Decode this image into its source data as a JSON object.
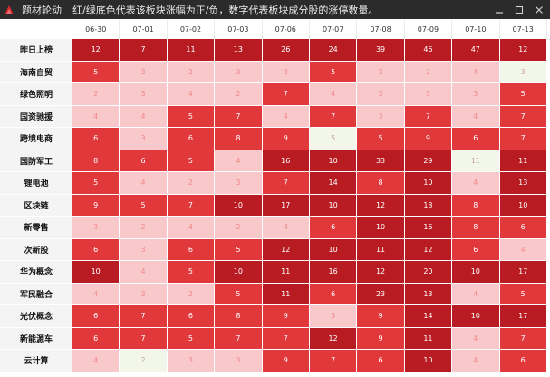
{
  "window": {
    "app_title": "题材轮动",
    "subtitle": "红/绿底色代表该板块涨幅为正/负，数字代表板块成分股的涨停数量。",
    "icon": "app-logo-icon",
    "buttons": [
      "minimize-icon",
      "maximize-icon",
      "close-icon"
    ]
  },
  "colors": {
    "deep_red": "#b81c22",
    "red": "#e0383b",
    "pink": "#f9c8ca",
    "pale_green": "#f3f7ea"
  },
  "dates": [
    "06-30",
    "07-01",
    "07-02",
    "07-03",
    "07-06",
    "07-07",
    "07-08",
    "07-09",
    "07-10",
    "07-13"
  ],
  "rows": [
    {
      "label": "昨日上榜",
      "values": [
        12,
        7,
        11,
        13,
        26,
        24,
        39,
        46,
        47,
        12
      ],
      "tones": [
        "d",
        "d",
        "d",
        "d",
        "d",
        "d",
        "d",
        "d",
        "d",
        "d"
      ]
    },
    {
      "label": "海南自贸",
      "values": [
        5,
        3,
        2,
        3,
        3,
        5,
        3,
        2,
        4,
        3
      ],
      "tones": [
        "r",
        "p",
        "p",
        "p",
        "p",
        "r",
        "p",
        "p",
        "p",
        "g"
      ]
    },
    {
      "label": "绿色照明",
      "values": [
        2,
        3,
        4,
        2,
        7,
        4,
        3,
        3,
        3,
        5
      ],
      "tones": [
        "p",
        "p",
        "p",
        "p",
        "r",
        "p",
        "p",
        "p",
        "p",
        "r"
      ]
    },
    {
      "label": "国资驰援",
      "values": [
        4,
        4,
        5,
        7,
        4,
        7,
        3,
        7,
        4,
        7
      ],
      "tones": [
        "p",
        "p",
        "r",
        "r",
        "p",
        "r",
        "p",
        "r",
        "p",
        "r"
      ]
    },
    {
      "label": "跨境电商",
      "values": [
        6,
        3,
        6,
        8,
        9,
        5,
        5,
        9,
        6,
        7
      ],
      "tones": [
        "r",
        "p",
        "r",
        "r",
        "r",
        "g",
        "r",
        "r",
        "r",
        "r"
      ]
    },
    {
      "label": "国防军工",
      "values": [
        8,
        6,
        5,
        4,
        16,
        10,
        33,
        29,
        11,
        11
      ],
      "tones": [
        "r",
        "r",
        "r",
        "p",
        "d",
        "d",
        "d",
        "d",
        "g",
        "d"
      ]
    },
    {
      "label": "锂电池",
      "values": [
        5,
        4,
        2,
        3,
        7,
        14,
        8,
        10,
        4,
        13
      ],
      "tones": [
        "r",
        "p",
        "p",
        "p",
        "r",
        "d",
        "r",
        "d",
        "p",
        "d"
      ]
    },
    {
      "label": "区块链",
      "values": [
        9,
        5,
        7,
        10,
        17,
        10,
        12,
        18,
        8,
        10
      ],
      "tones": [
        "r",
        "r",
        "r",
        "d",
        "d",
        "d",
        "d",
        "d",
        "r",
        "d"
      ]
    },
    {
      "label": "新零售",
      "values": [
        3,
        2,
        4,
        2,
        4,
        6,
        10,
        16,
        8,
        6
      ],
      "tones": [
        "p",
        "p",
        "p",
        "p",
        "p",
        "r",
        "d",
        "d",
        "r",
        "r"
      ]
    },
    {
      "label": "次新股",
      "values": [
        6,
        3,
        6,
        5,
        12,
        10,
        11,
        12,
        6,
        4
      ],
      "tones": [
        "r",
        "p",
        "r",
        "r",
        "d",
        "d",
        "d",
        "d",
        "r",
        "p"
      ]
    },
    {
      "label": "华为概念",
      "values": [
        10,
        4,
        5,
        10,
        11,
        16,
        12,
        20,
        10,
        17
      ],
      "tones": [
        "d",
        "p",
        "r",
        "d",
        "d",
        "d",
        "d",
        "d",
        "d",
        "d"
      ]
    },
    {
      "label": "军民融合",
      "values": [
        4,
        3,
        2,
        5,
        11,
        6,
        23,
        13,
        4,
        5
      ],
      "tones": [
        "p",
        "p",
        "p",
        "r",
        "d",
        "r",
        "d",
        "d",
        "p",
        "r"
      ]
    },
    {
      "label": "光伏概念",
      "values": [
        6,
        7,
        6,
        8,
        9,
        3,
        9,
        14,
        10,
        17
      ],
      "tones": [
        "r",
        "r",
        "r",
        "r",
        "r",
        "p",
        "r",
        "d",
        "d",
        "d"
      ]
    },
    {
      "label": "新能源车",
      "values": [
        6,
        7,
        5,
        7,
        7,
        12,
        9,
        11,
        4,
        7
      ],
      "tones": [
        "r",
        "r",
        "r",
        "r",
        "r",
        "d",
        "r",
        "d",
        "p",
        "r"
      ]
    },
    {
      "label": "云计算",
      "values": [
        4,
        2,
        3,
        3,
        9,
        7,
        6,
        10,
        4,
        6
      ],
      "tones": [
        "p",
        "g",
        "p",
        "p",
        "r",
        "r",
        "r",
        "d",
        "p",
        "r"
      ]
    }
  ]
}
